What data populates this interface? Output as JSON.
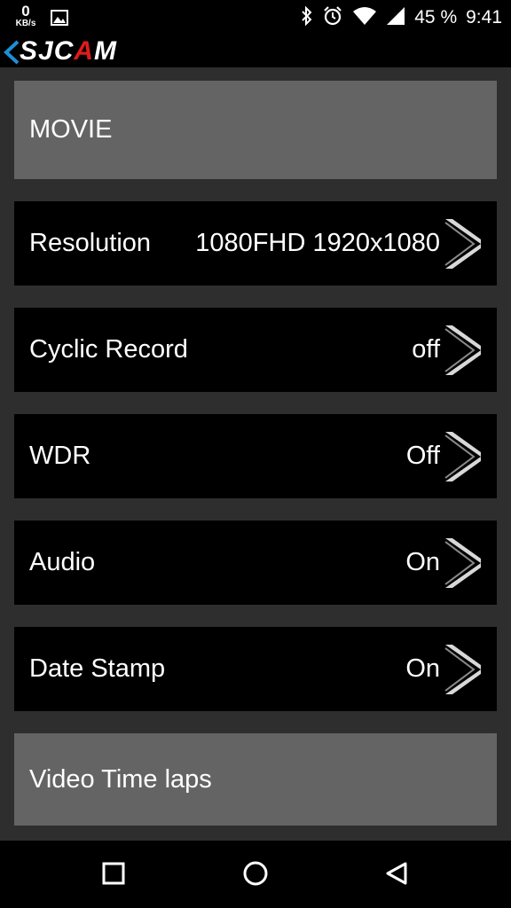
{
  "status_bar": {
    "net_speed_value": "0",
    "net_speed_unit": "KB/s",
    "battery": "45 %",
    "time": "9:41",
    "icons": [
      "image-icon",
      "bluetooth-icon",
      "alarm-icon",
      "wifi-icon",
      "signal-icon"
    ]
  },
  "app_bar": {
    "logo_prefix": "SJC",
    "logo_accent": "A",
    "logo_suffix": "M",
    "accent_color": "#e01b1b"
  },
  "sections": [
    {
      "type": "header",
      "label": "MOVIE"
    },
    {
      "type": "item",
      "label": "Resolution",
      "value": "1080FHD 1920x1080"
    },
    {
      "type": "item",
      "label": "Cyclic Record",
      "value": "off"
    },
    {
      "type": "item",
      "label": "WDR",
      "value": "Off"
    },
    {
      "type": "item",
      "label": "Audio",
      "value": "On"
    },
    {
      "type": "item",
      "label": "Date Stamp",
      "value": "On"
    },
    {
      "type": "header",
      "label": "Video Time laps"
    }
  ],
  "nav_bar": {
    "buttons": [
      "recents-button",
      "home-button",
      "back-button"
    ]
  }
}
